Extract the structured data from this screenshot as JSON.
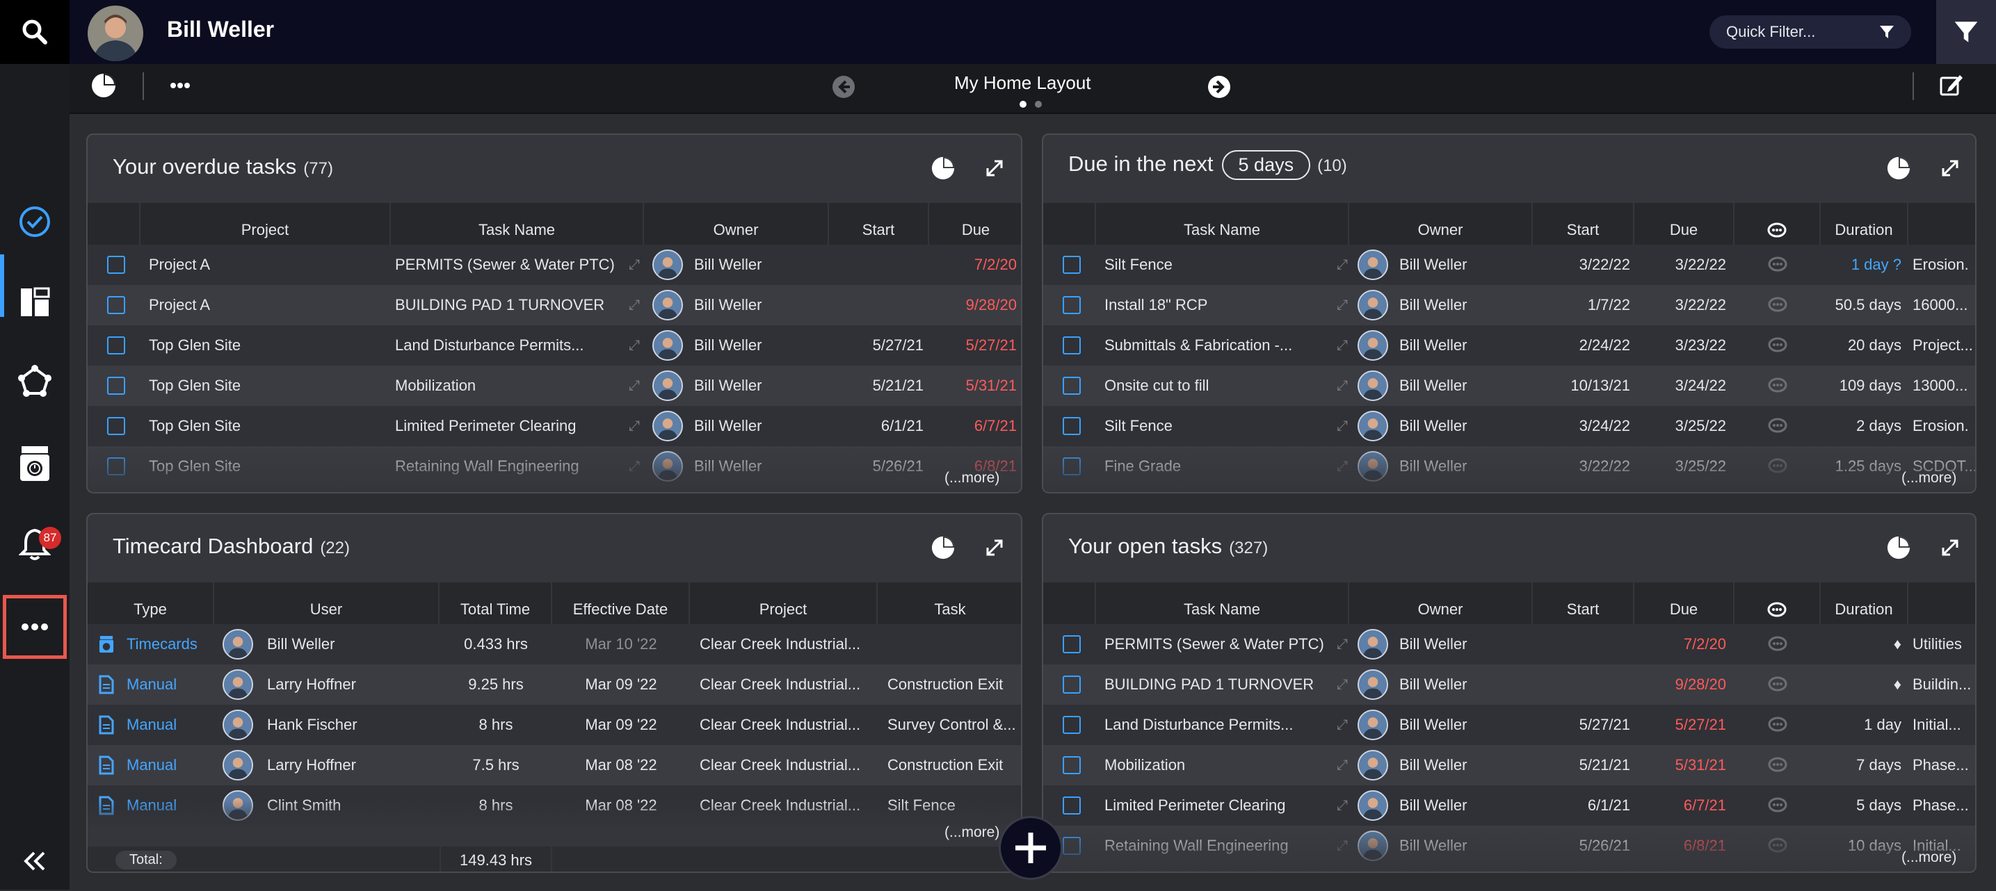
{
  "header": {
    "user_name": "Bill Weller",
    "quick_filter_placeholder": "Quick Filter...",
    "layout_title": "My Home Layout",
    "notifications_count": "87"
  },
  "overdue": {
    "title": "Your overdue tasks",
    "count": "(77)",
    "columns": [
      "Project",
      "Task Name",
      "Owner",
      "Start",
      "Due"
    ],
    "rows": [
      [
        "Project A",
        "PERMITS (Sewer & Water PTC)",
        "Bill Weller",
        "",
        "7/2/20"
      ],
      [
        "Project A",
        "BUILDING PAD 1 TURNOVER",
        "Bill Weller",
        "",
        "9/28/20"
      ],
      [
        "Top Glen Site",
        "Land Disturbance Permits...",
        "Bill Weller",
        "5/27/21",
        "5/27/21"
      ],
      [
        "Top Glen Site",
        "Mobilization",
        "Bill Weller",
        "5/21/21",
        "5/31/21"
      ],
      [
        "Top Glen Site",
        "Limited Perimeter Clearing",
        "Bill Weller",
        "6/1/21",
        "6/7/21"
      ],
      [
        "Top Glen Site",
        "Retaining Wall Engineering",
        "Bill Weller",
        "5/26/21",
        "6/8/21"
      ]
    ],
    "more": "(...more)"
  },
  "due_next": {
    "title": "Due in the next",
    "days": "5 days",
    "count": "(10)",
    "columns": [
      "Task Name",
      "Owner",
      "Start",
      "Due",
      "Duration"
    ],
    "rows": [
      [
        "Silt Fence",
        "Bill Weller",
        "3/22/22",
        "3/22/22",
        "1 day ?",
        "Erosion."
      ],
      [
        "Install 18\" RCP",
        "Bill Weller",
        "1/7/22",
        "3/22/22",
        "50.5 days",
        "16000..."
      ],
      [
        "Submittals & Fabrication -...",
        "Bill Weller",
        "2/24/22",
        "3/23/22",
        "20 days",
        "Project..."
      ],
      [
        "Onsite cut to fill",
        "Bill Weller",
        "10/13/21",
        "3/24/22",
        "109 days",
        "13000..."
      ],
      [
        "Silt Fence",
        "Bill Weller",
        "3/24/22",
        "3/25/22",
        "2 days",
        "Erosion."
      ],
      [
        "Fine Grade",
        "Bill Weller",
        "3/22/22",
        "3/25/22",
        "1.25 days",
        "SCDOT..."
      ]
    ],
    "more": "(...more)"
  },
  "timecard": {
    "title": "Timecard Dashboard",
    "count": "(22)",
    "columns": [
      "Type",
      "User",
      "Total Time",
      "Effective Date",
      "Project",
      "Task"
    ],
    "rows": [
      [
        "Timecards",
        "Bill Weller",
        "0.433 hrs",
        "Mar 10 '22",
        "Clear Creek Industrial...",
        ""
      ],
      [
        "Manual",
        "Larry Hoffner",
        "9.25 hrs",
        "Mar 09 '22",
        "Clear Creek Industrial...",
        "Construction Exit"
      ],
      [
        "Manual",
        "Hank Fischer",
        "8 hrs",
        "Mar 09 '22",
        "Clear Creek Industrial...",
        "Survey Control &..."
      ],
      [
        "Manual",
        "Larry Hoffner",
        "7.5 hrs",
        "Mar 08 '22",
        "Clear Creek Industrial...",
        "Construction Exit"
      ],
      [
        "Manual",
        "Clint Smith",
        "8 hrs",
        "Mar 08 '22",
        "Clear Creek Industrial...",
        "Silt Fence"
      ]
    ],
    "total_label": "Total:",
    "total_value": "149.43 hrs",
    "more": "(...more)"
  },
  "open": {
    "title": "Your open tasks",
    "count": "(327)",
    "columns": [
      "Task Name",
      "Owner",
      "Start",
      "Due",
      "Duration"
    ],
    "rows": [
      [
        "PERMITS (Sewer & Water PTC)",
        "Bill Weller",
        "",
        "7/2/20",
        "♦",
        "Utilities"
      ],
      [
        "BUILDING PAD 1 TURNOVER",
        "Bill Weller",
        "",
        "9/28/20",
        "♦",
        "Buildin..."
      ],
      [
        "Land Disturbance Permits...",
        "Bill Weller",
        "5/27/21",
        "5/27/21",
        "1 day",
        "Initial..."
      ],
      [
        "Mobilization",
        "Bill Weller",
        "5/21/21",
        "5/31/21",
        "7 days",
        "Phase..."
      ],
      [
        "Limited Perimeter Clearing",
        "Bill Weller",
        "6/1/21",
        "6/7/21",
        "5 days",
        "Phase..."
      ],
      [
        "Retaining Wall Engineering",
        "Bill Weller",
        "5/26/21",
        "6/8/21",
        "10 days",
        "Initial..."
      ]
    ],
    "more": "(...more)"
  },
  "colors": {
    "accent": "#3ba0ff",
    "overdue_red": "#ff5a5a",
    "badge_red": "#d62b2b",
    "highlight": "#e9574c"
  }
}
